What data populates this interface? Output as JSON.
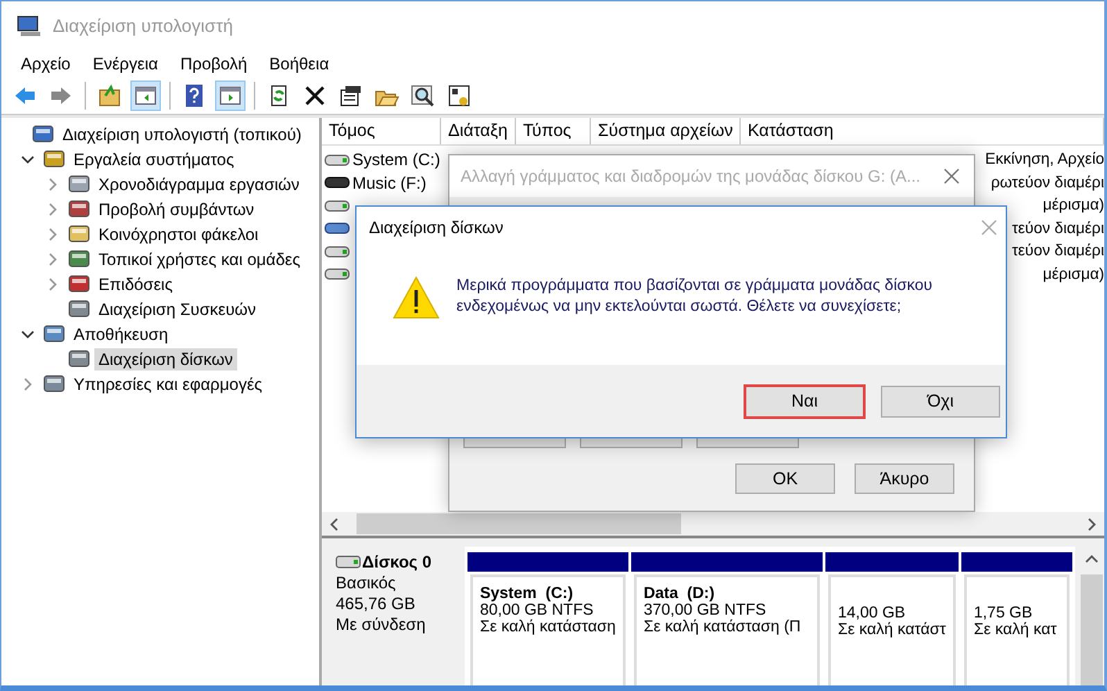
{
  "window": {
    "title": "Διαχείριση υπολογιστή"
  },
  "menu": [
    "Αρχείο",
    "Ενέργεια",
    "Προβολή",
    "Βοήθεια"
  ],
  "toolbar": [
    {
      "kind": "back",
      "pressed": false
    },
    {
      "kind": "forward",
      "pressed": false
    },
    {
      "kind": "sep"
    },
    {
      "kind": "up",
      "pressed": false
    },
    {
      "kind": "tree",
      "pressed": true
    },
    {
      "kind": "sep"
    },
    {
      "kind": "help",
      "pressed": false
    },
    {
      "kind": "pane",
      "pressed": true
    },
    {
      "kind": "sep"
    },
    {
      "kind": "refresh",
      "pressed": false
    },
    {
      "kind": "delete",
      "pressed": false
    },
    {
      "kind": "properties",
      "pressed": false
    },
    {
      "kind": "open",
      "pressed": false
    },
    {
      "kind": "search",
      "pressed": false
    },
    {
      "kind": "settings",
      "pressed": false
    }
  ],
  "tree": [
    {
      "label": "Διαχείριση υπολογιστή (τοπικού)",
      "kind": "computer",
      "selected": false,
      "children": [
        {
          "label": "Εργαλεία συστήματος",
          "kind": "tools",
          "selected": false,
          "expanded": true,
          "children": [
            {
              "label": "Χρονοδιάγραμμα εργασιών",
              "kind": "clock",
              "selected": false,
              "expanded": false
            },
            {
              "label": "Προβολή συμβάντων",
              "kind": "log",
              "selected": false,
              "expanded": false
            },
            {
              "label": "Κοινόχρηστοι φάκελοι",
              "kind": "folder",
              "selected": false,
              "expanded": false
            },
            {
              "label": "Τοπικοί χρήστες και ομάδες",
              "kind": "users",
              "selected": false,
              "expanded": false
            },
            {
              "label": "Επιδόσεις",
              "kind": "gauge",
              "selected": false,
              "expanded": false
            },
            {
              "label": "Διαχείριση Συσκευών",
              "kind": "device",
              "selected": false
            }
          ]
        },
        {
          "label": "Αποθήκευση",
          "kind": "storage",
          "selected": false,
          "expanded": true,
          "children": [
            {
              "label": "Διαχείριση δίσκων",
              "kind": "device",
              "selected": true
            }
          ]
        },
        {
          "label": "Υπηρεσίες και εφαρμογές",
          "kind": "services",
          "selected": false,
          "expanded": false
        }
      ]
    }
  ],
  "volumes": {
    "columns": [
      "Τόμος",
      "Διάταξη",
      "Τύπος",
      "Σύστημα αρχείων",
      "Κατάσταση"
    ],
    "rows": [
      {
        "name": "System (C:)",
        "kind": "disk",
        "status": "Εκκίνηση, Αρχείο"
      },
      {
        "name": "Music (F:)",
        "kind": "dark",
        "status": "ρωτεύον διαμέρι"
      },
      {
        "kind": "disk",
        "status": "μέρισμα)"
      },
      {
        "kind": "network",
        "status": "τεύον διαμέρι"
      },
      {
        "kind": "disk",
        "status": "τεύον διαμέρι"
      },
      {
        "kind": "disk",
        "status": "μέρισμα)"
      }
    ]
  },
  "disk": {
    "name": "Δίσκος 0",
    "type": "Βασικός",
    "size": "465,76 GB",
    "status": "Με σύνδεση",
    "partitions": [
      {
        "name": "System  (C:)",
        "size": "80,00 GB NTFS",
        "status": "Σε καλή κατάσταση"
      },
      {
        "name": "Data  (D:)",
        "size": "370,00 GB NTFS",
        "status": "Σε καλή κατάσταση (Π"
      },
      {
        "size": "14,00 GB",
        "status": "Σε καλή κατάστ"
      },
      {
        "size": "1,75 GB",
        "status": "Σε καλή κατ"
      }
    ]
  },
  "back_dialog": {
    "title": "Αλλαγή γράμματος και διαδρομών της μονάδας δίσκου G: (A...",
    "buttons": [
      "OK",
      "Άκυρο"
    ]
  },
  "dialog": {
    "title": "Διαχείριση δίσκων",
    "message": "Μερικά προγράμματα που βασίζονται σε γράμματα μονάδας δίσκου\nενδεχομένως να μην εκτελούνται σωστά. Θέλετε να συνεχίσετε;",
    "buttons": [
      {
        "label": "Ναι",
        "highlighted": true
      },
      {
        "label": "Όχι",
        "highlighted": false
      }
    ]
  }
}
